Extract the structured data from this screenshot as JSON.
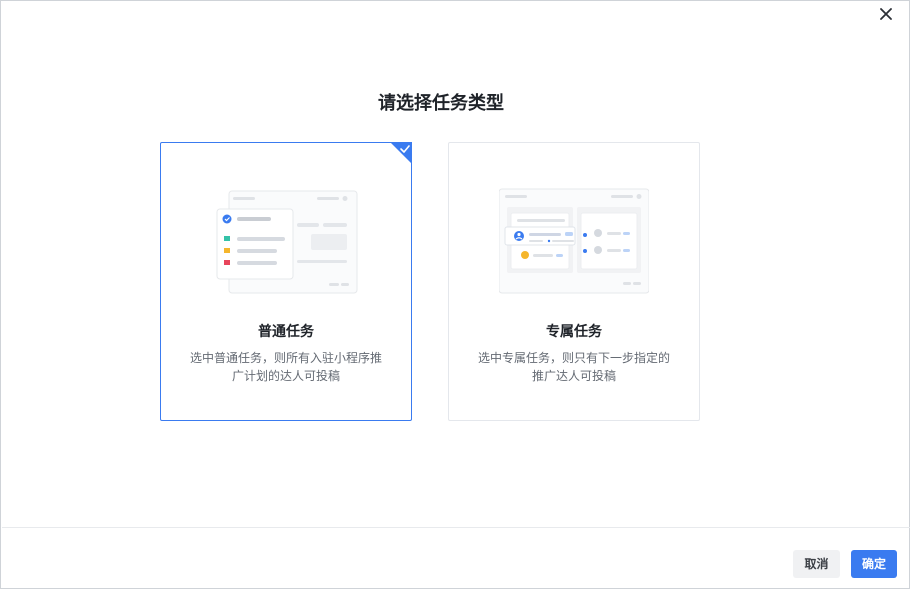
{
  "dialog": {
    "title": "请选择任务类型",
    "close_icon": "close-icon"
  },
  "cards": [
    {
      "title": "普通任务",
      "description": "选中普通任务，则所有入驻小程序推广计划的达人可投稿",
      "selected": true,
      "illustration": "normal-task-illustration"
    },
    {
      "title": "专属任务",
      "description": "选中专属任务，则只有下一步指定的推广达人可投稿",
      "selected": false,
      "illustration": "exclusive-task-illustration"
    }
  ],
  "footer": {
    "cancel_label": "取消",
    "confirm_label": "确定"
  },
  "colors": {
    "accent": "#3a7bf0",
    "border": "#e4e7ec"
  }
}
